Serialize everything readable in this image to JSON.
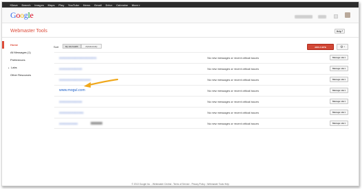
{
  "topnav": {
    "items": [
      "+Dave",
      "Search",
      "Images",
      "Maps",
      "Play",
      "YouTube",
      "News",
      "Gmail",
      "Drive",
      "Calendar"
    ],
    "more": "More"
  },
  "logo": "Google",
  "app_title": "Webmaster Tools",
  "help_label": "Help",
  "sidebar": {
    "items": [
      {
        "label": "Home",
        "active": true
      },
      {
        "label": "All Messages (1)"
      },
      {
        "label": "Preferences"
      },
      {
        "label": "Labs",
        "expandable": true
      },
      {
        "label": "Other Resources"
      }
    ]
  },
  "sort": {
    "label": "Sort",
    "options": [
      "By site health",
      "Alphabetically"
    ],
    "selected": "By site health"
  },
  "add_site_label": "ADD A SITE",
  "settings_icon": "gear-icon",
  "sites": [
    {
      "url": "",
      "status": "No new messages or recent critical issues",
      "blurred": true
    },
    {
      "url": "",
      "status": "No new messages or recent critical issues",
      "blurred": true
    },
    {
      "url": "",
      "status": "No new messages or recent critical issues",
      "blurred": true
    },
    {
      "url": "www.mogul.com",
      "status": "No new messages or recent critical issues",
      "highlighted": true
    },
    {
      "url": "",
      "status": "No new messages or recent critical issues",
      "blurred": true
    },
    {
      "url": "",
      "status": "No new messages or recent critical issues",
      "blurred": true
    },
    {
      "url": "",
      "status": "No new messages or recent critical issues",
      "blurred": true
    }
  ],
  "manage_site_label": "Manage site",
  "footer": "© 2013 Google Inc. - Webmaster Central - Terms of Service - Privacy Policy - Webmaster Tools Help",
  "colors": {
    "accent": "#dd4b39",
    "add_button": "#d14836",
    "link": "#1155cc",
    "arrow": "#f0a81c",
    "topbar": "#2d2d2d"
  }
}
